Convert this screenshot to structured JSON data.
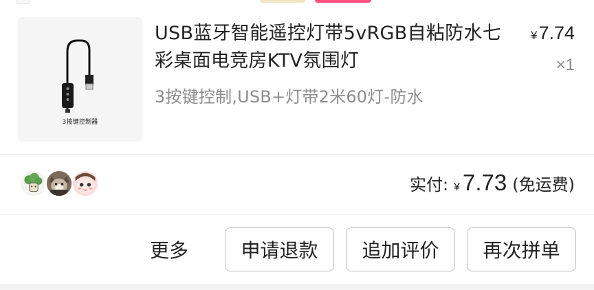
{
  "product": {
    "thumbnail_caption": "3按键控制器",
    "title": "USB蓝牙智能遥控灯带5vRGB自粘防水七彩桌面电竞房KTV氛围灯",
    "price_symbol": "¥",
    "price": "7.74",
    "quantity": "×1",
    "spec": "3按键控制,USB+灯带2米60灯-防水"
  },
  "payment": {
    "label": "实付:",
    "currency_symbol": "¥",
    "amount": "7.73",
    "note": "(免运费)"
  },
  "group_avatars": [
    {
      "icon": "broccoli-avatar-icon"
    },
    {
      "icon": "cat-avatar-icon"
    },
    {
      "icon": "cartoon-face-avatar-icon"
    }
  ],
  "actions": {
    "more": "更多",
    "refund": "申请退款",
    "review": "追加评价",
    "rebuy": "再次拼单"
  },
  "colors": {
    "accent_pink": "#ff4f7e",
    "border": "#bdbdbd",
    "muted_text": "#8c8c8c"
  }
}
